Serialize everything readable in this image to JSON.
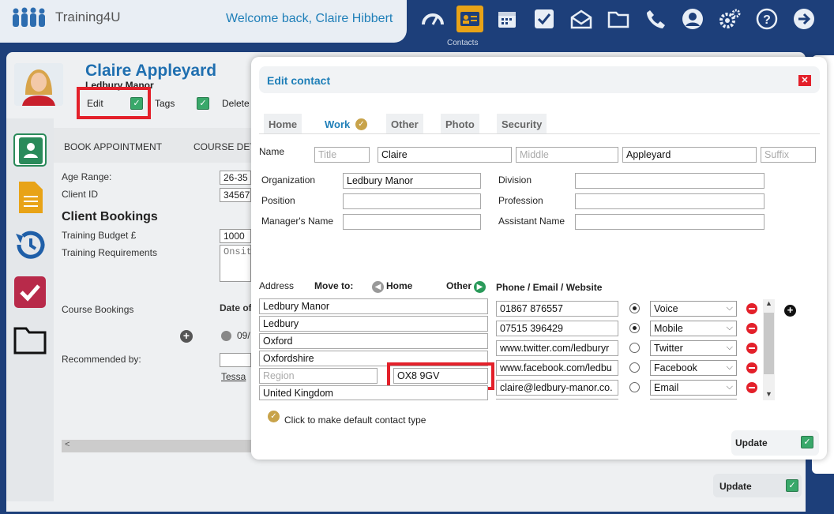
{
  "app": {
    "brand": "Training4U",
    "welcome": "Welcome back, Claire Hibbert",
    "active_nav_label": "Contacts"
  },
  "nav_icons": [
    "dashboard-icon",
    "contacts-icon",
    "calendar-icon",
    "tasks-icon",
    "mail-icon",
    "folder-icon",
    "phone-icon",
    "account-icon",
    "settings-icon",
    "help-icon",
    "logout-icon"
  ],
  "background": {
    "contact_name": "Claire Appleyard",
    "contact_org": "Ledbury Manor",
    "actions": {
      "edit": "Edit",
      "tags": "Tags",
      "delete": "Delete"
    },
    "tabs": {
      "book": "BOOK APPOINTMENT",
      "course": "COURSE DET"
    },
    "age_range_label": "Age Range:",
    "age_range_value": "26-35",
    "client_id_label": "Client ID",
    "client_id_value": "34567",
    "bookings_heading": "Client Bookings",
    "budget_label": "Training Budget £",
    "budget_value": "1000",
    "requirements_label": "Training Requirements",
    "requirements_value": "Onsit",
    "course_bookings_label": "Course Bookings",
    "date_label": "Date of",
    "date_value": "09/",
    "recommended_label": "Recommended by:",
    "recommended_value": "Tessa",
    "update": "Update"
  },
  "modal": {
    "title": "Edit contact",
    "tabs": [
      "Home",
      "Work",
      "Other",
      "Photo",
      "Security"
    ],
    "name": {
      "label": "Name",
      "title_ph": "Title",
      "first": "Claire",
      "middle_ph": "Middle",
      "last": "Appleyard",
      "suffix_ph": "Suffix"
    },
    "work": {
      "organization_label": "Organization",
      "organization": "Ledbury Manor",
      "position_label": "Position",
      "position": "",
      "manager_label": "Manager's Name",
      "manager": "",
      "division_label": "Division",
      "division": "",
      "profession_label": "Profession",
      "profession": "",
      "assistant_label": "Assistant Name",
      "assistant": ""
    },
    "address": {
      "label": "Address",
      "move_to": "Move to:",
      "home": "Home",
      "other": "Other",
      "line1": "Ledbury Manor",
      "line2": "Ledbury",
      "city": "Oxford",
      "county": "Oxfordshire",
      "region_ph": "Region",
      "postcode": "OX8 9GV",
      "country": "United Kingdom"
    },
    "phone_heading": "Phone / Email / Website",
    "contacts": [
      {
        "value": "01867 876557",
        "type": "Voice",
        "selected": true
      },
      {
        "value": "07515 396429",
        "type": "Mobile",
        "selected": true
      },
      {
        "value": "www.twitter.com/ledburyr",
        "type": "Twitter",
        "selected": false
      },
      {
        "value": "www.facebook.com/ledbu",
        "type": "Facebook",
        "selected": false
      },
      {
        "value": "claire@ledbury-manor.co.",
        "type": "Email",
        "selected": false
      }
    ],
    "default_note": "Click to make default contact type",
    "update": "Update"
  }
}
